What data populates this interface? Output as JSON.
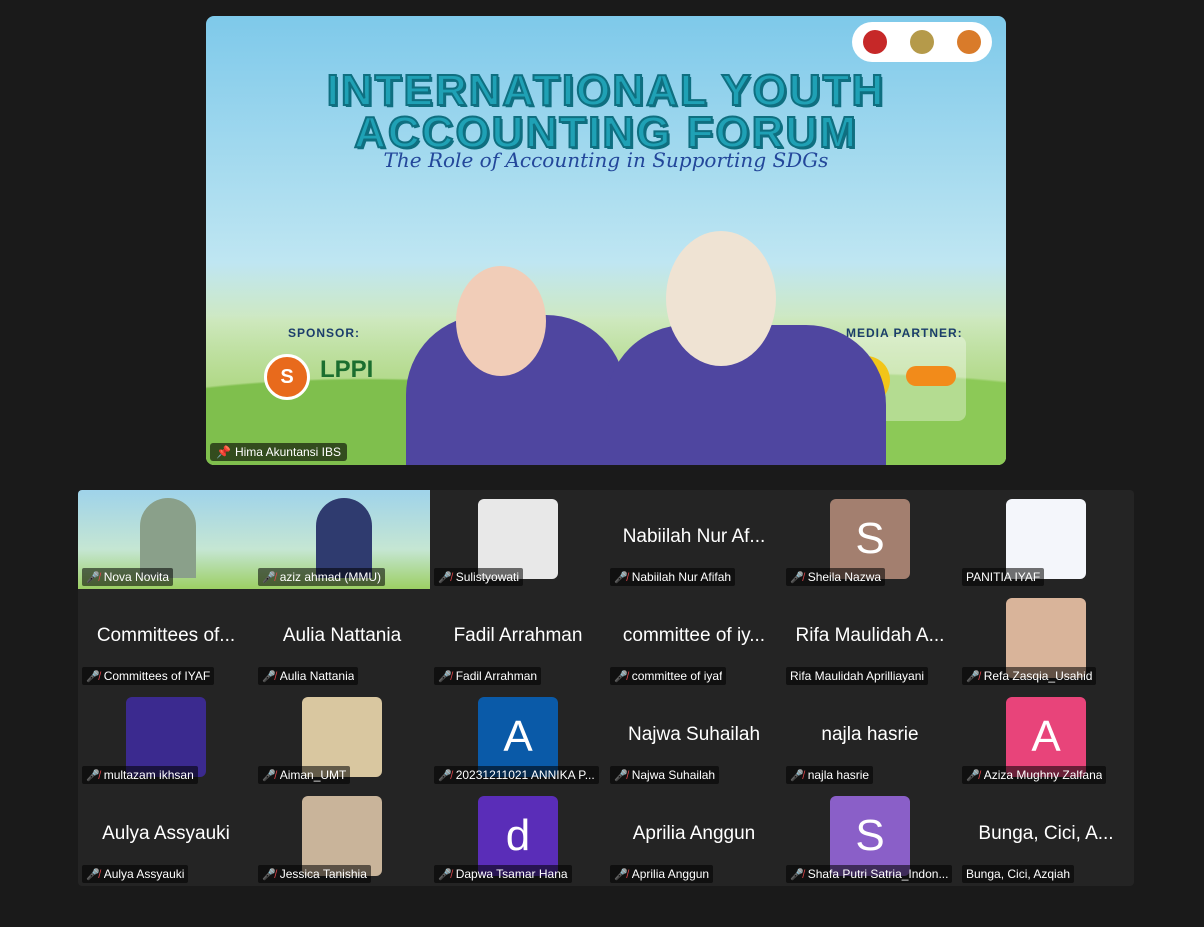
{
  "speaker": {
    "title_line1": "INTERNATIONAL YOUTH",
    "title_line2": "ACCOUNTING FORUM",
    "subtitle": "The Role of Accounting in Supporting SDGs",
    "sponsor_label": "SPONSOR:",
    "media_label": "MEDIA PARTNER:",
    "sponsor_logo_text": "S",
    "lppi_text": "LPPI",
    "name": "Hima Akuntansi IBS",
    "pin_icon": "pin-icon"
  },
  "participants": [
    {
      "tile_text": "",
      "label": "Nova Novita",
      "muted": true,
      "kind": "video",
      "avatar": ""
    },
    {
      "tile_text": "",
      "label": "aziz ahmad (MMU)",
      "muted": true,
      "kind": "video",
      "avatar": ""
    },
    {
      "tile_text": "",
      "label": "Sulistyowati",
      "muted": true,
      "kind": "photo",
      "avatar": "",
      "color": "#e8e8e8"
    },
    {
      "tile_text": "Nabiilah Nur Af...",
      "label": "Nabiilah Nur Afifah",
      "muted": true,
      "kind": "name",
      "avatar": ""
    },
    {
      "tile_text": "",
      "label": "Sheila Nazwa",
      "muted": true,
      "kind": "letter",
      "avatar": "S",
      "color": "#a37f6f"
    },
    {
      "tile_text": "",
      "label": "PANITIA IYAF",
      "muted": false,
      "kind": "photo",
      "avatar": "",
      "color": "#f4f6fb"
    },
    {
      "tile_text": "Committees of...",
      "label": "Committees of IYAF",
      "muted": true,
      "kind": "name",
      "avatar": ""
    },
    {
      "tile_text": "Aulia Nattania",
      "label": "Aulia Nattania",
      "muted": true,
      "kind": "name",
      "avatar": ""
    },
    {
      "tile_text": "Fadil Arrahman",
      "label": "Fadil Arrahman",
      "muted": true,
      "kind": "name",
      "avatar": ""
    },
    {
      "tile_text": "committee of iy...",
      "label": "committee of iyaf",
      "muted": true,
      "kind": "name",
      "avatar": ""
    },
    {
      "tile_text": "Rifa Maulidah A...",
      "label": "Rifa Maulidah Aprilliayani",
      "muted": false,
      "kind": "name",
      "avatar": ""
    },
    {
      "tile_text": "",
      "label": "Refa Zasqia_Usahid",
      "muted": true,
      "kind": "photo",
      "avatar": "",
      "color": "#d9b49a"
    },
    {
      "tile_text": "",
      "label": "multazam ikhsan",
      "muted": true,
      "kind": "photo",
      "avatar": "",
      "color": "#3b2a8f"
    },
    {
      "tile_text": "",
      "label": "Aiman_UMT",
      "muted": true,
      "kind": "photo",
      "avatar": "",
      "color": "#d9c7a0"
    },
    {
      "tile_text": "",
      "label": "20231211021 ANNIKA P...",
      "muted": true,
      "kind": "letter",
      "avatar": "A",
      "color": "#0a5aa8"
    },
    {
      "tile_text": "Najwa Suhailah",
      "label": "Najwa Suhailah",
      "muted": true,
      "kind": "name",
      "avatar": ""
    },
    {
      "tile_text": "najla hasrie",
      "label": "najla hasrie",
      "muted": true,
      "kind": "name",
      "avatar": ""
    },
    {
      "tile_text": "",
      "label": "Aziza Mughny Zalfana",
      "muted": true,
      "kind": "letter",
      "avatar": "A",
      "color": "#e8447a"
    },
    {
      "tile_text": "Aulya Assyauki",
      "label": "Aulya Assyauki",
      "muted": true,
      "kind": "name",
      "avatar": ""
    },
    {
      "tile_text": "",
      "label": "Jessica Tanishia",
      "muted": true,
      "kind": "photo",
      "avatar": "",
      "color": "#c9b49a"
    },
    {
      "tile_text": "",
      "label": "Dapwa Tsamar Hana",
      "muted": true,
      "kind": "letter",
      "avatar": "d",
      "color": "#5a2db8"
    },
    {
      "tile_text": "Aprilia Anggun",
      "label": "Aprilia Anggun",
      "muted": true,
      "kind": "name",
      "avatar": ""
    },
    {
      "tile_text": "",
      "label": "Shafa Putri Satria_Indon...",
      "muted": true,
      "kind": "letter",
      "avatar": "S",
      "color": "#8a5fc8"
    },
    {
      "tile_text": "Bunga, Cici, A...",
      "label": "Bunga, Cici, Azqiah",
      "muted": false,
      "kind": "name",
      "avatar": ""
    }
  ],
  "icons": {
    "muted": "mic-muted-icon"
  }
}
